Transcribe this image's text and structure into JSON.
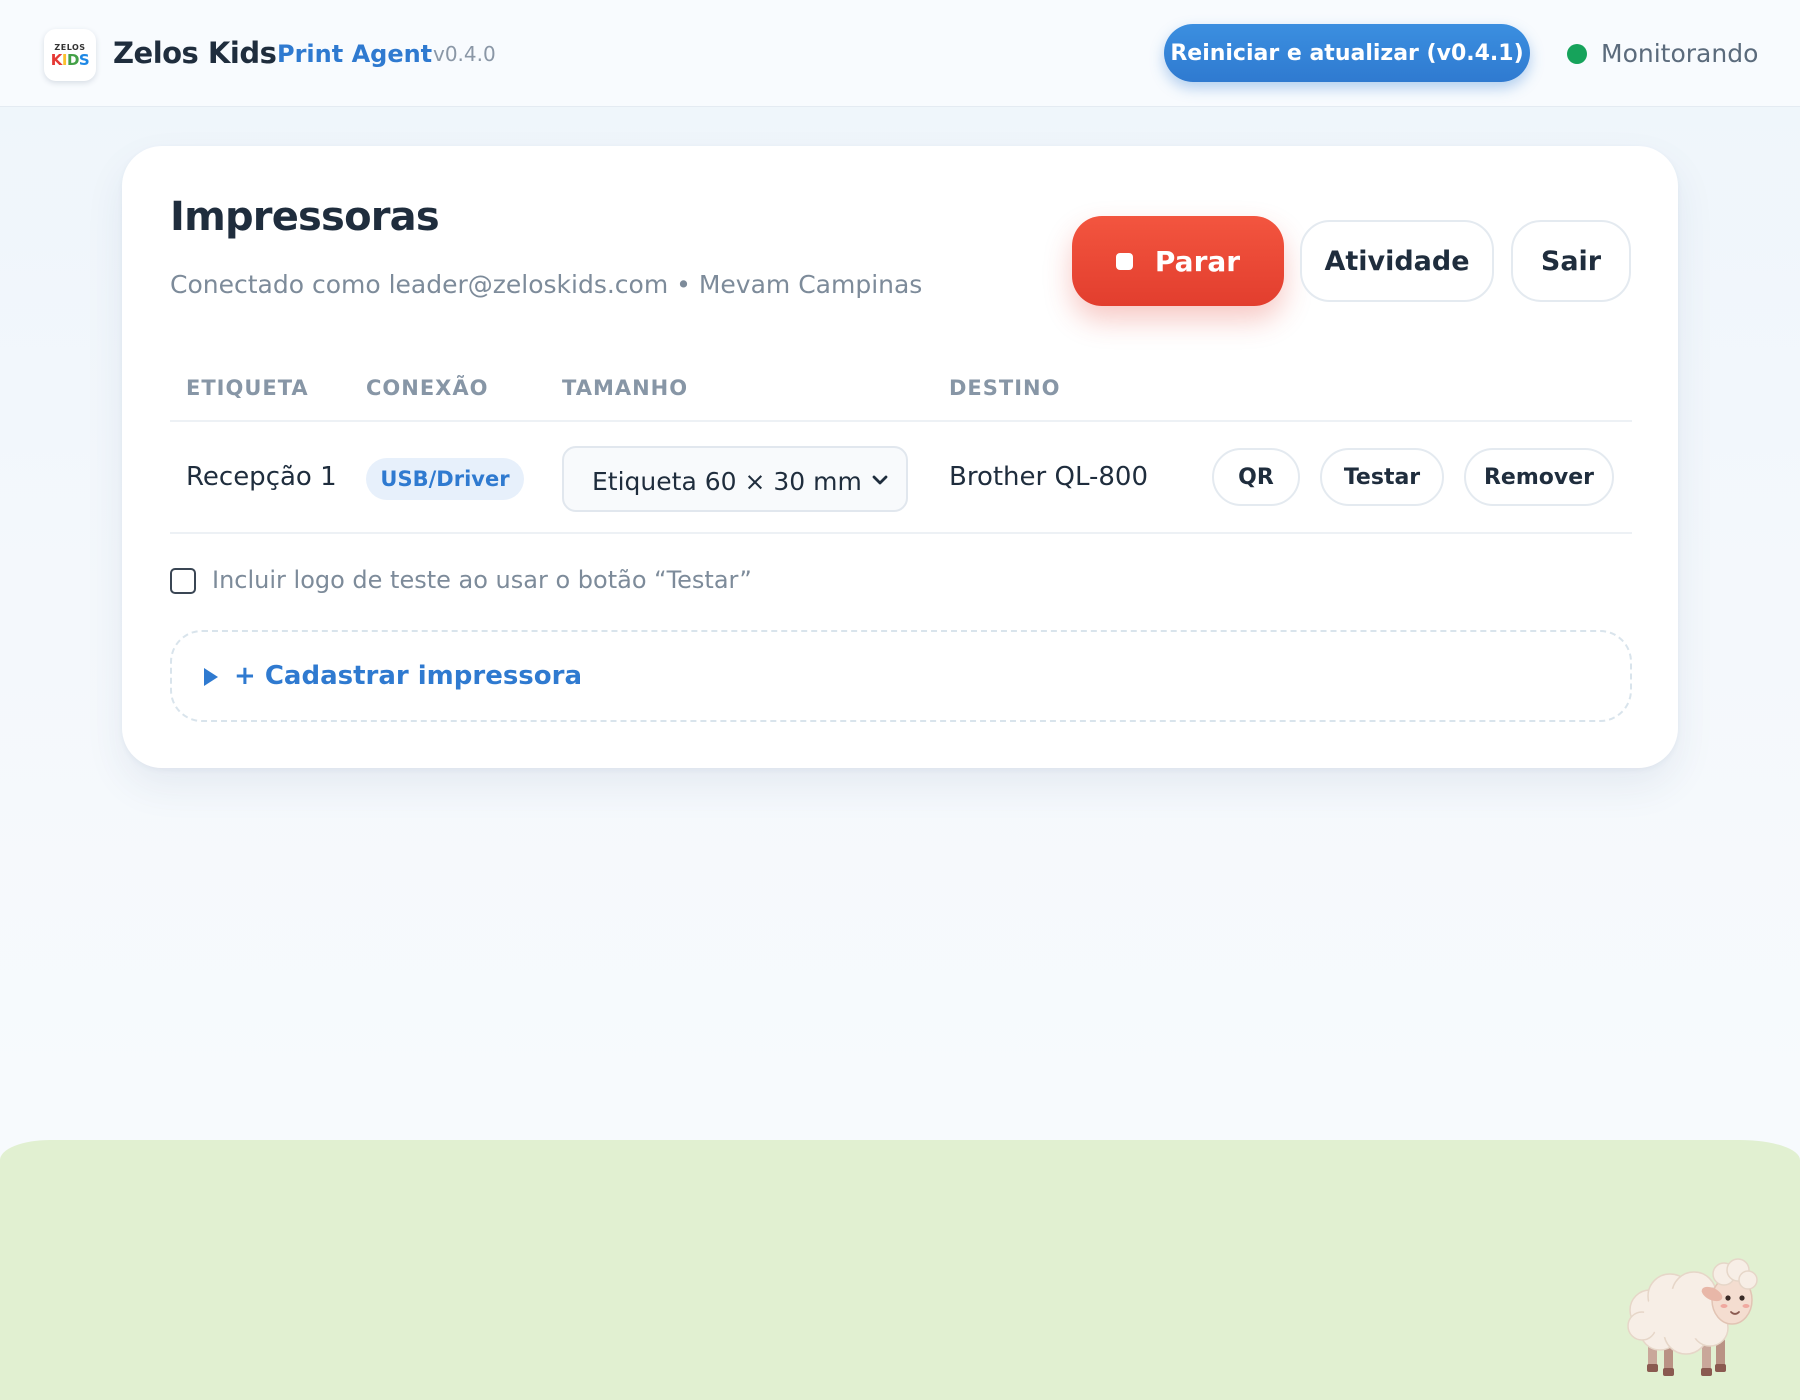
{
  "header": {
    "logo_top": "ZELOS",
    "logo_bottom": [
      "K",
      "I",
      "D",
      "S"
    ],
    "brand": "Zelos Kids",
    "product": "Print Agent",
    "version": "v0.4.0",
    "update_button": "Reiniciar e atualizar (v0.4.1)",
    "status": "Monitorando",
    "status_color": "#16a35b",
    "accent_color": "#2f7ad0"
  },
  "card": {
    "title": "Impressoras",
    "subtitle": "Conectado como leader@zeloskids.com • Mevam Campinas",
    "stop_button": "Parar",
    "activity_button": "Atividade",
    "exit_button": "Sair",
    "stop_color": "#e23e2e"
  },
  "table": {
    "headers": [
      "ETIQUETA",
      "CONEXÃO",
      "TAMANHO",
      "DESTINO"
    ],
    "rows": [
      {
        "label": "Recepção 1",
        "connection": "USB/Driver",
        "size": "Etiqueta 60 × 30 mm",
        "destination": "Brother QL-800",
        "actions": [
          "QR",
          "Testar",
          "Remover"
        ]
      }
    ]
  },
  "test_logo_option": {
    "label": "Incluir logo de teste ao usar o botão “Testar”",
    "checked": false
  },
  "register": {
    "label": "+ Cadastrar impressora",
    "expanded": false
  },
  "icons": {
    "stop": "stop-square-icon",
    "select": "chevron-down-icon",
    "disclosure": "triangle-right-icon",
    "mascot": "sheep-icon"
  }
}
